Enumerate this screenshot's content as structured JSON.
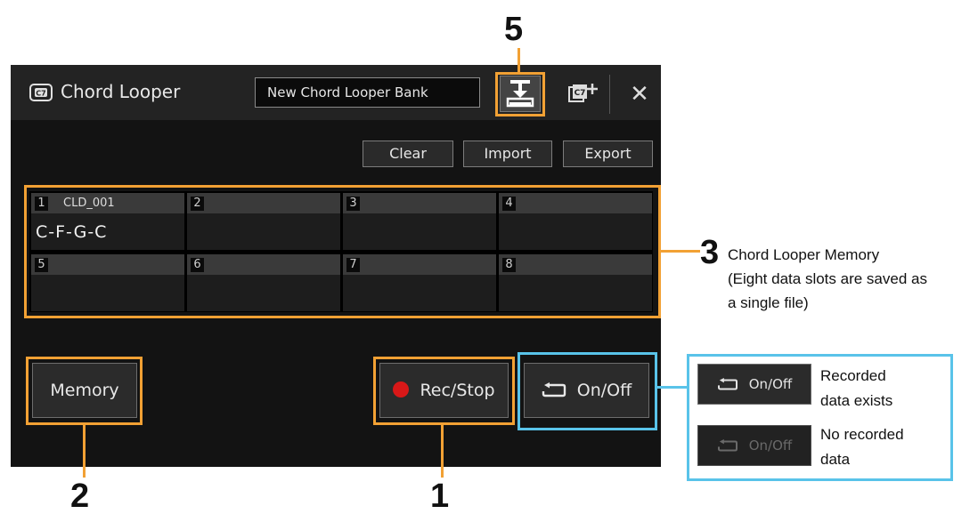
{
  "window": {
    "title": "Chord Looper",
    "bank_name": "New Chord Looper Bank",
    "close_glyph": "✕"
  },
  "toolbar": {
    "clear_label": "Clear",
    "import_label": "Import",
    "export_label": "Export"
  },
  "memory_slots": [
    {
      "number": "1",
      "name": "CLD_001",
      "chords": "C-F-G-C"
    },
    {
      "number": "2",
      "name": "",
      "chords": ""
    },
    {
      "number": "3",
      "name": "",
      "chords": ""
    },
    {
      "number": "4",
      "name": "",
      "chords": ""
    },
    {
      "number": "5",
      "name": "",
      "chords": ""
    },
    {
      "number": "6",
      "name": "",
      "chords": ""
    },
    {
      "number": "7",
      "name": "",
      "chords": ""
    },
    {
      "number": "8",
      "name": "",
      "chords": ""
    }
  ],
  "controls": {
    "memory_label": "Memory",
    "rec_stop_label": "Rec/Stop",
    "on_off_label": "On/Off"
  },
  "callouts": {
    "n1": "1",
    "n2": "2",
    "n3": "3",
    "n5": "5",
    "memory_note_line1": "Chord Looper Memory",
    "memory_note_line2": "(Eight data slots are saved as",
    "memory_note_line3": "a single file)"
  },
  "legend": {
    "on_off_label": "On/Off",
    "recorded_line1": "Recorded",
    "recorded_line2": "data exists",
    "none_line1": "No recorded",
    "none_line2": "data"
  },
  "colors": {
    "callout_orange": "#f2a134",
    "callout_blue": "#59c3e9",
    "record_red": "#d81818"
  }
}
